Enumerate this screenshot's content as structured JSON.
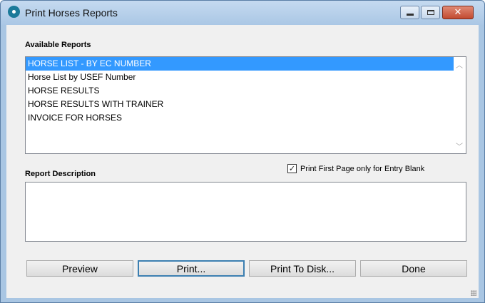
{
  "window": {
    "title": "Print Horses Reports",
    "icon": "app-ring-icon",
    "controls": [
      "minimize-icon",
      "maximize-icon",
      "close-icon"
    ]
  },
  "available_reports": {
    "label": "Available Reports",
    "items": [
      {
        "label": "HORSE LIST - BY EC NUMBER",
        "selected": true
      },
      {
        "label": "Horse List by USEF Number",
        "selected": false
      },
      {
        "label": "HORSE RESULTS",
        "selected": false
      },
      {
        "label": "HORSE RESULTS WITH TRAINER",
        "selected": false
      },
      {
        "label": "INVOICE FOR HORSES",
        "selected": false
      }
    ]
  },
  "report_description": {
    "label": "Report Description",
    "value": ""
  },
  "print_first_page": {
    "label": "Print First Page only for Entry Blank",
    "checked": true
  },
  "buttons": {
    "preview": "Preview",
    "print": "Print...",
    "print_to_disk": "Print To Disk...",
    "done": "Done"
  },
  "colors": {
    "selection": "#3399ff",
    "titlebar": "#aac7e5",
    "close_button": "#c24a30"
  }
}
